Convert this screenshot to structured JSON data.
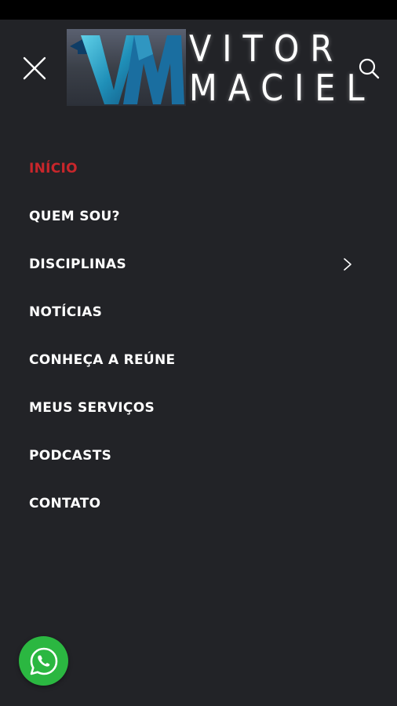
{
  "logo": {
    "mark": "VM",
    "line1": "VITOR",
    "line2": "MACIEL"
  },
  "header": {
    "close_icon": "close-icon",
    "search_icon": "search-icon"
  },
  "nav": {
    "items": [
      {
        "label": "INÍCIO",
        "active": true
      },
      {
        "label": "QUEM SOU?"
      },
      {
        "label": "DISCIPLINAS",
        "has_submenu": true
      },
      {
        "label": "NOTÍCIAS"
      },
      {
        "label": "CONHEÇA A REÚNE"
      },
      {
        "label": "MEUS SERVIÇOS"
      },
      {
        "label": "PODCASTS"
      },
      {
        "label": "CONTATO"
      }
    ]
  },
  "whatsapp": {
    "icon": "whatsapp-icon"
  },
  "colors": {
    "background": "#222327",
    "active": "#c8262b",
    "text": "#ffffff",
    "whatsapp": "#2bb741"
  }
}
